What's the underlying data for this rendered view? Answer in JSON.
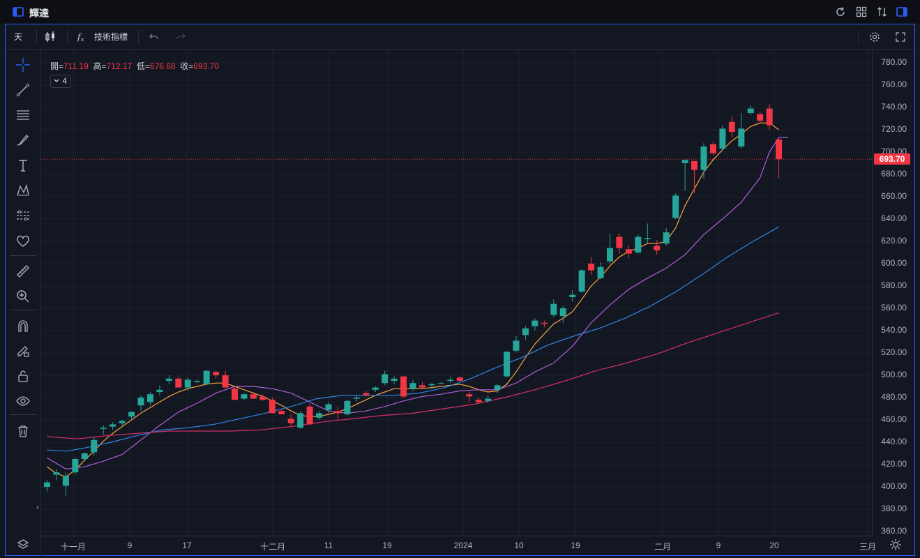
{
  "window": {
    "title": "輝達",
    "icons": [
      "panel-left-icon",
      "refresh-icon",
      "grid-layout-icon",
      "sort-icon",
      "panel-right-icon"
    ]
  },
  "toolbar": {
    "interval": "天",
    "chart_type_icon": "candlestick-icon",
    "indicators_label": "技術指標",
    "indicators_icon": "fx-icon",
    "undo_icon": "undo-icon",
    "redo_icon": "redo-icon",
    "settings_icon": "gear-icon",
    "fullscreen_icon": "fullscreen-icon"
  },
  "left_tools": [
    "crosshair-icon",
    "trend-line-icon",
    "horizontal-lines-icon",
    "brush-icon",
    "text-icon",
    "pattern-icon",
    "measure-ranges-icon",
    "heart-icon",
    "ruler-icon",
    "zoom-in-icon",
    "magnet-icon",
    "lock-pencil-icon",
    "unlock-icon",
    "eye-icon",
    "trash-icon"
  ],
  "legend": {
    "open_label": "開=",
    "open": "711.19",
    "high_label": "高=",
    "high": "712.17",
    "low_label": "低=",
    "low": "676.68",
    "close_label": "收=",
    "close": "693.70",
    "indicator_count": "4"
  },
  "price_axis": {
    "ticks": [
      "780.00",
      "760.00",
      "740.00",
      "720.00",
      "700.00",
      "680.00",
      "660.00",
      "640.00",
      "620.00",
      "600.00",
      "580.00",
      "560.00",
      "540.00",
      "520.00",
      "500.00",
      "480.00",
      "460.00",
      "440.00",
      "420.00",
      "400.00",
      "380.00",
      "360.00"
    ],
    "last_price": "693.70"
  },
  "time_axis": {
    "ticks": [
      "十一月",
      "9",
      "17",
      "十二月",
      "11",
      "19",
      "2024",
      "10",
      "19",
      "二月",
      "9",
      "20",
      "三月"
    ]
  },
  "colors": {
    "up": "#26a69a",
    "down": "#f23645",
    "ma_orange": "#f7a440",
    "ma_purple": "#b05fd6",
    "ma_blue": "#2f86e6",
    "ma_pink": "#d62f6b",
    "accent": "#2962ff"
  },
  "chart_data": {
    "type": "candlestick",
    "y_range": [
      356,
      786
    ],
    "candles": [
      {
        "o": 400,
        "h": 406,
        "l": 396,
        "c": 404
      },
      {
        "o": 411,
        "h": 416,
        "l": 406,
        "c": 413
      },
      {
        "o": 401,
        "h": 413,
        "l": 392,
        "c": 410
      },
      {
        "o": 413,
        "h": 426,
        "l": 411,
        "c": 425
      },
      {
        "o": 425,
        "h": 431,
        "l": 423,
        "c": 430
      },
      {
        "o": 431,
        "h": 445,
        "l": 428,
        "c": 442
      },
      {
        "o": 452,
        "h": 455,
        "l": 447,
        "c": 453
      },
      {
        "o": 454,
        "h": 458,
        "l": 451,
        "c": 456
      },
      {
        "o": 457,
        "h": 460,
        "l": 455,
        "c": 459
      },
      {
        "o": 463,
        "h": 468,
        "l": 460,
        "c": 467
      },
      {
        "o": 473,
        "h": 482,
        "l": 468,
        "c": 480
      },
      {
        "o": 476,
        "h": 485,
        "l": 473,
        "c": 483
      },
      {
        "o": 485,
        "h": 491,
        "l": 482,
        "c": 487
      },
      {
        "o": 495,
        "h": 500,
        "l": 492,
        "c": 497
      },
      {
        "o": 497,
        "h": 499,
        "l": 489,
        "c": 489
      },
      {
        "o": 489,
        "h": 498,
        "l": 486,
        "c": 496
      },
      {
        "o": 494,
        "h": 496,
        "l": 493,
        "c": 495
      },
      {
        "o": 492,
        "h": 505,
        "l": 491,
        "c": 504
      },
      {
        "o": 503,
        "h": 504,
        "l": 497,
        "c": 500
      },
      {
        "o": 500,
        "h": 504,
        "l": 489,
        "c": 489
      },
      {
        "o": 488,
        "h": 490,
        "l": 478,
        "c": 478
      },
      {
        "o": 479,
        "h": 484,
        "l": 478,
        "c": 483
      },
      {
        "o": 483,
        "h": 485,
        "l": 479,
        "c": 479
      },
      {
        "o": 481,
        "h": 483,
        "l": 477,
        "c": 478
      },
      {
        "o": 478,
        "h": 480,
        "l": 466,
        "c": 466
      },
      {
        "o": 468,
        "h": 470,
        "l": 465,
        "c": 465
      },
      {
        "o": 461,
        "h": 465,
        "l": 455,
        "c": 457
      },
      {
        "o": 453,
        "h": 468,
        "l": 452,
        "c": 466
      },
      {
        "o": 472,
        "h": 474,
        "l": 455,
        "c": 456
      },
      {
        "o": 462,
        "h": 468,
        "l": 460,
        "c": 466
      },
      {
        "o": 469,
        "h": 476,
        "l": 466,
        "c": 474
      },
      {
        "o": 468,
        "h": 472,
        "l": 460,
        "c": 466
      },
      {
        "o": 465,
        "h": 478,
        "l": 464,
        "c": 477
      },
      {
        "o": 479,
        "h": 482,
        "l": 476,
        "c": 480
      },
      {
        "o": 484,
        "h": 486,
        "l": 481,
        "c": 482
      },
      {
        "o": 487,
        "h": 490,
        "l": 485,
        "c": 489
      },
      {
        "o": 493,
        "h": 504,
        "l": 491,
        "c": 501
      },
      {
        "o": 495,
        "h": 499,
        "l": 492,
        "c": 497
      },
      {
        "o": 499,
        "h": 499,
        "l": 480,
        "c": 481
      },
      {
        "o": 488,
        "h": 496,
        "l": 486,
        "c": 493
      },
      {
        "o": 491,
        "h": 494,
        "l": 488,
        "c": 489
      },
      {
        "o": 491,
        "h": 493,
        "l": 488,
        "c": 492
      },
      {
        "o": 493,
        "h": 494,
        "l": 492,
        "c": 493
      },
      {
        "o": 495,
        "h": 499,
        "l": 493,
        "c": 496
      },
      {
        "o": 498,
        "h": 499,
        "l": 495,
        "c": 495
      },
      {
        "o": 483,
        "h": 485,
        "l": 475,
        "c": 481
      },
      {
        "o": 478,
        "h": 480,
        "l": 475,
        "c": 476
      },
      {
        "o": 477,
        "h": 482,
        "l": 475,
        "c": 479
      },
      {
        "o": 487,
        "h": 492,
        "l": 484,
        "c": 491
      },
      {
        "o": 499,
        "h": 522,
        "l": 498,
        "c": 521
      },
      {
        "o": 522,
        "h": 535,
        "l": 521,
        "c": 531
      },
      {
        "o": 536,
        "h": 544,
        "l": 532,
        "c": 542
      },
      {
        "o": 544,
        "h": 551,
        "l": 540,
        "c": 549
      },
      {
        "o": 547,
        "h": 549,
        "l": 543,
        "c": 546
      },
      {
        "o": 554,
        "h": 568,
        "l": 552,
        "c": 564
      },
      {
        "o": 553,
        "h": 562,
        "l": 547,
        "c": 560
      },
      {
        "o": 570,
        "h": 576,
        "l": 566,
        "c": 572
      },
      {
        "o": 575,
        "h": 595,
        "l": 574,
        "c": 594
      },
      {
        "o": 600,
        "h": 606,
        "l": 590,
        "c": 594
      },
      {
        "o": 587,
        "h": 601,
        "l": 586,
        "c": 597
      },
      {
        "o": 602,
        "h": 627,
        "l": 600,
        "c": 614
      },
      {
        "o": 624,
        "h": 627,
        "l": 609,
        "c": 614
      },
      {
        "o": 613,
        "h": 616,
        "l": 605,
        "c": 609
      },
      {
        "o": 610,
        "h": 626,
        "l": 609,
        "c": 624
      },
      {
        "o": 622,
        "h": 636,
        "l": 618,
        "c": 623
      },
      {
        "o": 616,
        "h": 621,
        "l": 608,
        "c": 612
      },
      {
        "o": 618,
        "h": 632,
        "l": 616,
        "c": 628
      },
      {
        "o": 641,
        "h": 663,
        "l": 640,
        "c": 661
      },
      {
        "o": 690,
        "h": 692,
        "l": 665,
        "c": 693
      },
      {
        "o": 692,
        "h": 692,
        "l": 663,
        "c": 684
      },
      {
        "o": 684,
        "h": 708,
        "l": 676,
        "c": 705
      },
      {
        "o": 707,
        "h": 709,
        "l": 697,
        "c": 699
      },
      {
        "o": 703,
        "h": 724,
        "l": 701,
        "c": 721
      },
      {
        "o": 727,
        "h": 732,
        "l": 713,
        "c": 718
      },
      {
        "o": 705,
        "h": 735,
        "l": 703,
        "c": 721
      },
      {
        "o": 735,
        "h": 742,
        "l": 733,
        "c": 739
      },
      {
        "o": 734,
        "h": 736,
        "l": 726,
        "c": 728
      },
      {
        "o": 739,
        "h": 743,
        "l": 720,
        "c": 724
      },
      {
        "o": 711.19,
        "h": 712.17,
        "l": 676.68,
        "c": 693.7
      }
    ],
    "ma_series": [
      {
        "color": "#f7a440",
        "points": [
          [
            0,
            418
          ],
          [
            1,
            412
          ],
          [
            2,
            409
          ],
          [
            3,
            415
          ],
          [
            4,
            424
          ],
          [
            5,
            432
          ],
          [
            6,
            441
          ],
          [
            7,
            448
          ],
          [
            8,
            454
          ],
          [
            9,
            460
          ],
          [
            10,
            466
          ],
          [
            11,
            471
          ],
          [
            12,
            476
          ],
          [
            13,
            481
          ],
          [
            14,
            485
          ],
          [
            15,
            488
          ],
          [
            16,
            490
          ],
          [
            17,
            492
          ],
          [
            18,
            493
          ],
          [
            19,
            493
          ],
          [
            20,
            490
          ],
          [
            21,
            487
          ],
          [
            22,
            484
          ],
          [
            23,
            481
          ],
          [
            24,
            477
          ],
          [
            25,
            473
          ],
          [
            26,
            468
          ],
          [
            27,
            464
          ],
          [
            28,
            463
          ],
          [
            29,
            463
          ],
          [
            30,
            465
          ],
          [
            31,
            467
          ],
          [
            32,
            470
          ],
          [
            33,
            474
          ],
          [
            34,
            478
          ],
          [
            35,
            482
          ],
          [
            36,
            485
          ],
          [
            37,
            488
          ],
          [
            38,
            488
          ],
          [
            39,
            488
          ],
          [
            40,
            488
          ],
          [
            41,
            489
          ],
          [
            42,
            490
          ],
          [
            43,
            491
          ],
          [
            44,
            492
          ],
          [
            45,
            490
          ],
          [
            46,
            487
          ],
          [
            47,
            485
          ],
          [
            48,
            486
          ],
          [
            49,
            492
          ],
          [
            50,
            503
          ],
          [
            51,
            516
          ],
          [
            52,
            528
          ],
          [
            53,
            537
          ],
          [
            54,
            546
          ],
          [
            55,
            551
          ],
          [
            56,
            557
          ],
          [
            57,
            568
          ],
          [
            58,
            580
          ],
          [
            59,
            588
          ],
          [
            60,
            598
          ],
          [
            61,
            606
          ],
          [
            62,
            611
          ],
          [
            63,
            614
          ],
          [
            64,
            618
          ],
          [
            65,
            618
          ],
          [
            66,
            620
          ],
          [
            67,
            632
          ],
          [
            68,
            652
          ],
          [
            69,
            667
          ],
          [
            70,
            682
          ],
          [
            71,
            693
          ],
          [
            72,
            702
          ],
          [
            73,
            710
          ],
          [
            74,
            716
          ],
          [
            75,
            723
          ],
          [
            76,
            726
          ],
          [
            77,
            726
          ],
          [
            78,
            720
          ]
        ]
      },
      {
        "color": "#b05fd6",
        "points": [
          [
            0,
            426
          ],
          [
            2,
            416
          ],
          [
            4,
            418
          ],
          [
            6,
            423
          ],
          [
            8,
            429
          ],
          [
            10,
            442
          ],
          [
            12,
            455
          ],
          [
            14,
            467
          ],
          [
            16,
            475
          ],
          [
            18,
            484
          ],
          [
            20,
            490
          ],
          [
            22,
            490
          ],
          [
            24,
            488
          ],
          [
            26,
            484
          ],
          [
            28,
            476
          ],
          [
            30,
            468
          ],
          [
            32,
            466
          ],
          [
            34,
            468
          ],
          [
            36,
            472
          ],
          [
            38,
            477
          ],
          [
            40,
            481
          ],
          [
            42,
            483
          ],
          [
            44,
            486
          ],
          [
            46,
            487
          ],
          [
            48,
            487
          ],
          [
            50,
            493
          ],
          [
            52,
            503
          ],
          [
            54,
            511
          ],
          [
            56,
            526
          ],
          [
            58,
            547
          ],
          [
            60,
            563
          ],
          [
            62,
            577
          ],
          [
            64,
            587
          ],
          [
            66,
            596
          ],
          [
            68,
            608
          ],
          [
            70,
            626
          ],
          [
            72,
            640
          ],
          [
            74,
            655
          ],
          [
            76,
            677
          ],
          [
            77,
            700
          ],
          [
            78,
            713
          ],
          [
            79,
            713
          ]
        ]
      },
      {
        "color": "#2f86e6",
        "points": [
          [
            0,
            433
          ],
          [
            3,
            432
          ],
          [
            6,
            435
          ],
          [
            10,
            440
          ],
          [
            14,
            446
          ],
          [
            18,
            451
          ],
          [
            22,
            453
          ],
          [
            26,
            456
          ],
          [
            30,
            461
          ],
          [
            34,
            466
          ],
          [
            38,
            472
          ],
          [
            42,
            479
          ],
          [
            46,
            482
          ],
          [
            50,
            482
          ],
          [
            54,
            482
          ],
          [
            58,
            484
          ],
          [
            62,
            489
          ],
          [
            66,
            497
          ],
          [
            70,
            507
          ],
          [
            74,
            516
          ],
          [
            78,
            527
          ],
          [
            82,
            535
          ],
          [
            86,
            542
          ],
          [
            90,
            551
          ],
          [
            94,
            562
          ],
          [
            98,
            575
          ],
          [
            102,
            590
          ],
          [
            106,
            606
          ],
          [
            110,
            620
          ],
          [
            114,
            633
          ]
        ]
      },
      {
        "color": "#d62f6b",
        "points": [
          [
            0,
            445
          ],
          [
            5,
            443
          ],
          [
            10,
            446
          ],
          [
            15,
            448
          ],
          [
            20,
            450
          ],
          [
            25,
            450
          ],
          [
            30,
            450
          ],
          [
            35,
            451
          ],
          [
            40,
            454
          ],
          [
            45,
            458
          ],
          [
            50,
            461
          ],
          [
            55,
            464
          ],
          [
            60,
            466
          ],
          [
            65,
            470
          ],
          [
            70,
            474
          ],
          [
            75,
            480
          ],
          [
            80,
            487
          ],
          [
            85,
            495
          ],
          [
            90,
            504
          ],
          [
            95,
            511
          ],
          [
            100,
            519
          ],
          [
            105,
            529
          ],
          [
            110,
            538
          ],
          [
            115,
            547
          ],
          [
            120,
            556
          ]
        ]
      }
    ]
  }
}
